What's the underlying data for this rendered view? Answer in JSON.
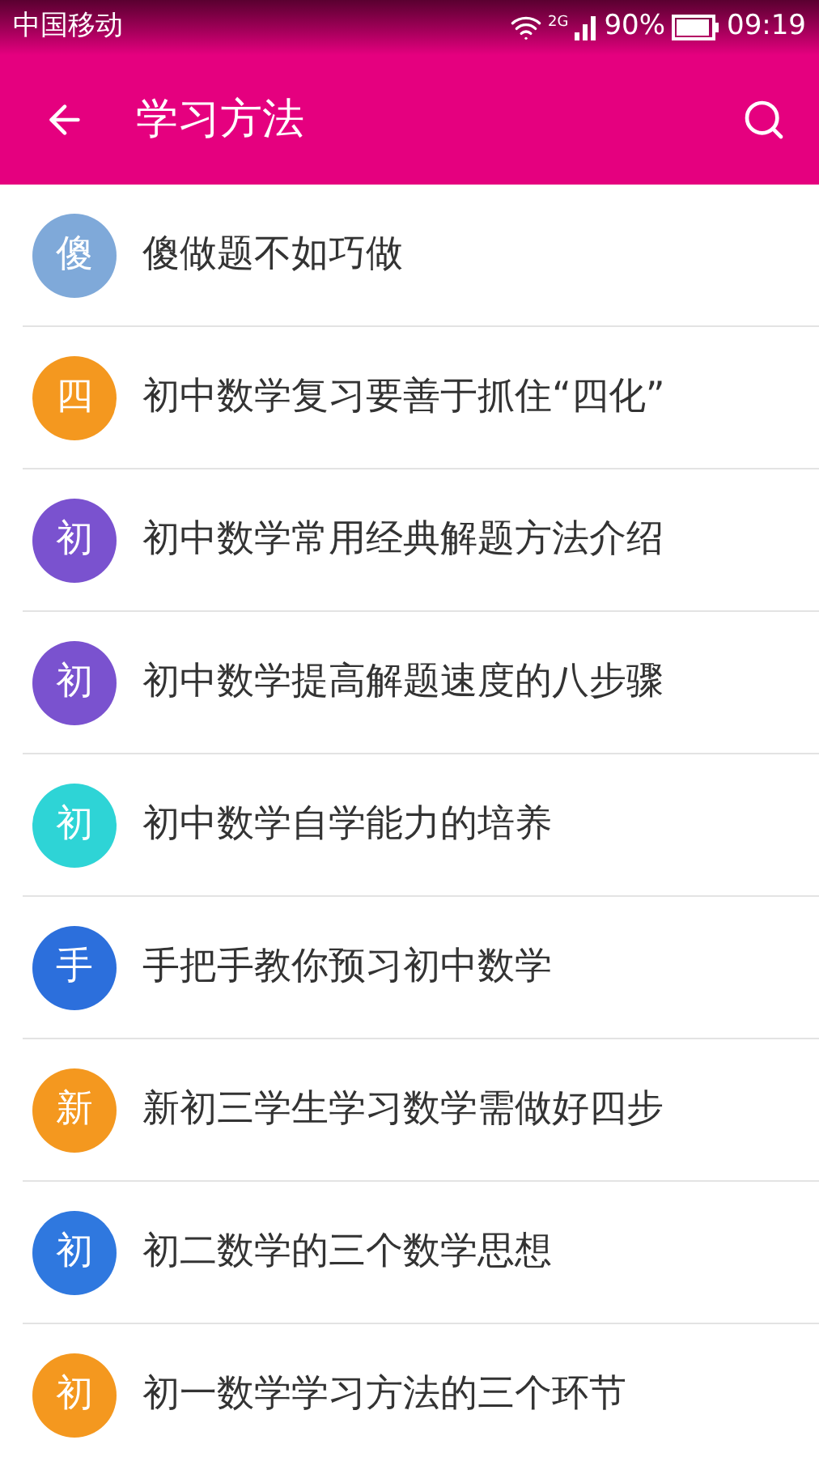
{
  "status_bar": {
    "carrier": "中国移动",
    "network": "2G",
    "battery": "90%",
    "time": "09:19"
  },
  "app_bar": {
    "title": "学习方法"
  },
  "items": [
    {
      "avatar": "傻",
      "title": "傻做题不如巧做",
      "color": "#7fa9d9"
    },
    {
      "avatar": "四",
      "title": "初中数学复习要善于抓住“四化”",
      "color": "#f4981f"
    },
    {
      "avatar": "初",
      "title": "初中数学常用经典解题方法介绍",
      "color": "#7a52cf"
    },
    {
      "avatar": "初",
      "title": "初中数学提高解题速度的八步骤",
      "color": "#7a52cf"
    },
    {
      "avatar": "初",
      "title": "初中数学自学能力的培养",
      "color": "#2ed4d6"
    },
    {
      "avatar": "手",
      "title": "手把手教你预习初中数学",
      "color": "#2c6fdc"
    },
    {
      "avatar": "新",
      "title": "新初三学生学习数学需做好四步",
      "color": "#f4981f"
    },
    {
      "avatar": "初",
      "title": "初二数学的三个数学思想",
      "color": "#2f78df"
    },
    {
      "avatar": "初",
      "title": "初一数学学习方法的三个环节",
      "color": "#f4981f"
    }
  ]
}
